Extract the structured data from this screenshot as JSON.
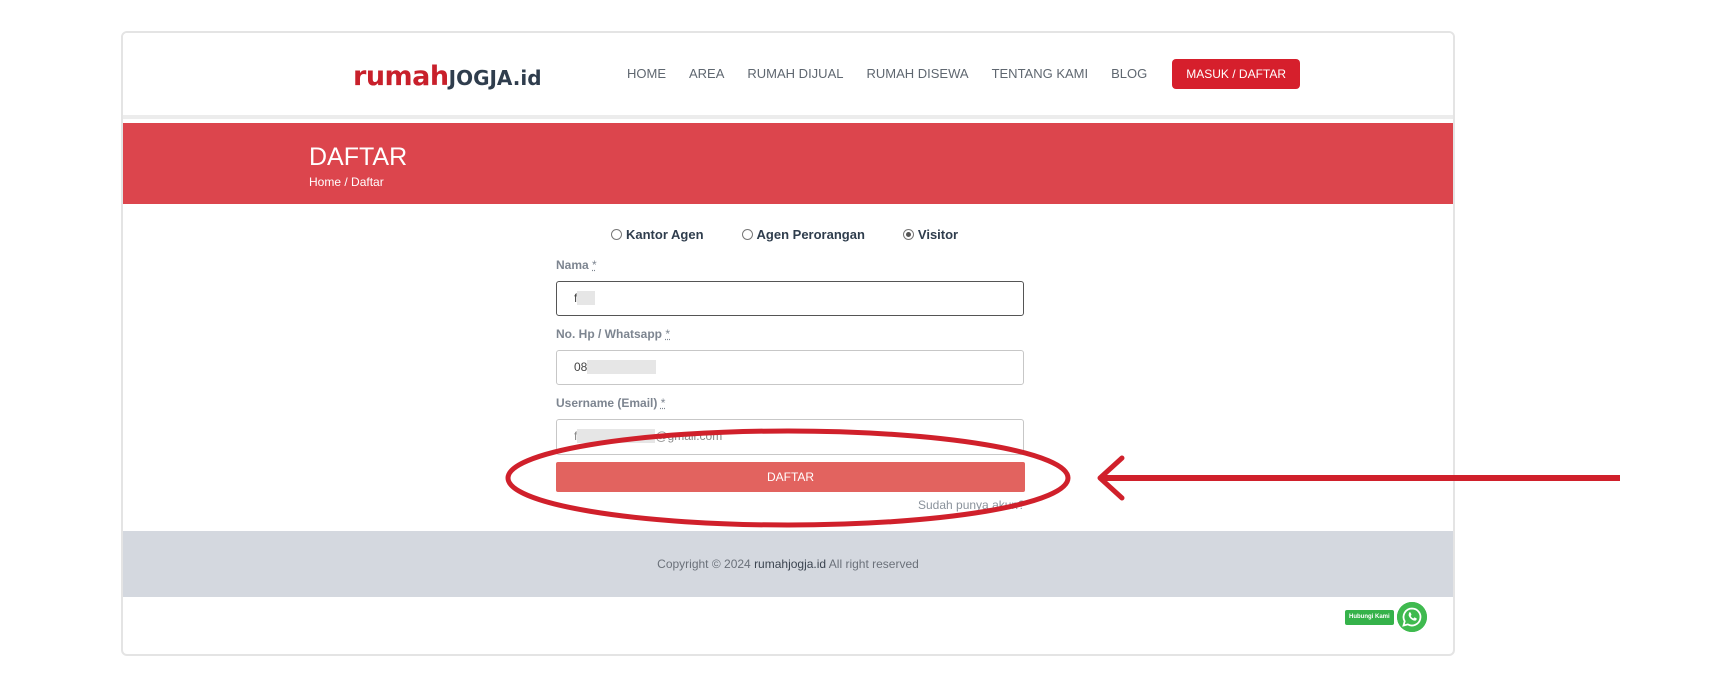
{
  "header": {
    "logo": {
      "part1": "rumah",
      "part2": "JOGJA",
      "part3": ".id"
    },
    "nav": [
      {
        "label": "HOME"
      },
      {
        "label": "AREA"
      },
      {
        "label": "RUMAH DIJUAL"
      },
      {
        "label": "RUMAH DISEWA"
      },
      {
        "label": "TENTANG KAMI"
      },
      {
        "label": "BLOG"
      }
    ],
    "login_button": "MASUK / DAFTAR"
  },
  "banner": {
    "title": "DAFTAR",
    "breadcrumb": {
      "home": "Home",
      "separator": " / ",
      "current": "Daftar"
    }
  },
  "form": {
    "account_types": [
      {
        "label": "Kantor Agen",
        "selected": false
      },
      {
        "label": "Agen Perorangan",
        "selected": false
      },
      {
        "label": "Visitor",
        "selected": true
      }
    ],
    "name": {
      "label": "Nama",
      "required": "*",
      "value": "f"
    },
    "phone": {
      "label": "No. Hp / Whatsapp",
      "required": "*",
      "value": "08"
    },
    "email": {
      "label": "Username (Email)",
      "required": "*",
      "value_prefix": "f",
      "value_suffix": "@gmail.com"
    },
    "submit_label": "DAFTAR",
    "login_link": "Sudah punya akun?"
  },
  "footer": {
    "copyright_prefix": "Copyright © 2024 ",
    "brand": "rumahjogja.id",
    "copyright_suffix": " All right reserved"
  },
  "whatsapp": {
    "label": "Hubungi Kami"
  },
  "colors": {
    "brand_red": "#d61f2c",
    "banner_red": "#dc454d",
    "submit_red": "#e2635f",
    "annotation_red": "#d0202b",
    "footer_gray": "#d4d8df",
    "whatsapp_green": "#3fba4f"
  }
}
